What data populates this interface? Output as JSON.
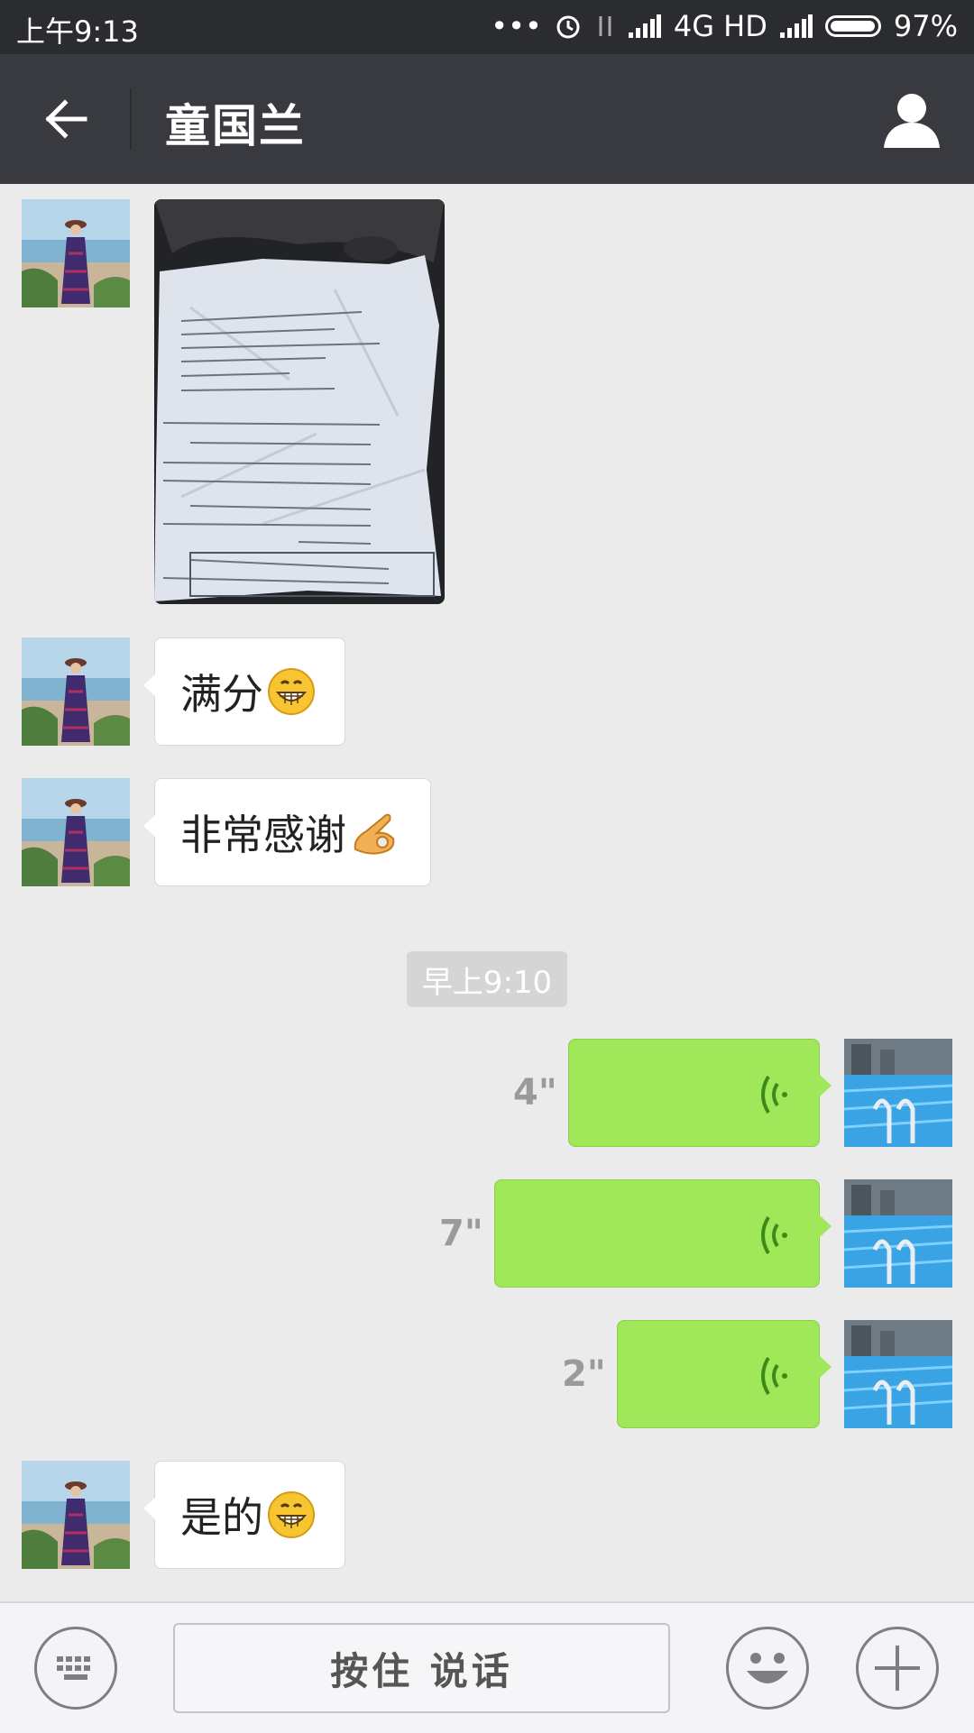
{
  "status_bar": {
    "time": "上午9:13",
    "network": "4G HD",
    "battery": "97%"
  },
  "header": {
    "title": "童国兰",
    "back_icon": "arrow-left-icon",
    "profile_icon": "person-icon"
  },
  "messages": [
    {
      "side": "left",
      "type": "image",
      "content": "photo-of-exam-receipt"
    },
    {
      "side": "left",
      "type": "text",
      "text": "满分",
      "emoji": "grin-emoji"
    },
    {
      "side": "left",
      "type": "text",
      "text": "非常感谢",
      "emoji": "ok-hand-emoji"
    },
    {
      "type": "timestamp",
      "text": "早上9:10"
    },
    {
      "side": "right",
      "type": "voice",
      "duration": "4\""
    },
    {
      "side": "right",
      "type": "voice",
      "duration": "7\""
    },
    {
      "side": "right",
      "type": "voice",
      "duration": "2\""
    },
    {
      "side": "left",
      "type": "text",
      "text": "是的",
      "emoji": "grin-emoji"
    }
  ],
  "input_bar": {
    "hold_to_talk_label": "按住 说话",
    "keyboard_icon": "keyboard-icon",
    "emoji_icon": "smiley-icon",
    "plus_icon": "plus-icon"
  },
  "colors": {
    "titlebar": "#393a3f",
    "statusbar": "#2b2c2f",
    "chat_bg": "#ebebeb",
    "voice_bubble": "#a0e75a"
  }
}
